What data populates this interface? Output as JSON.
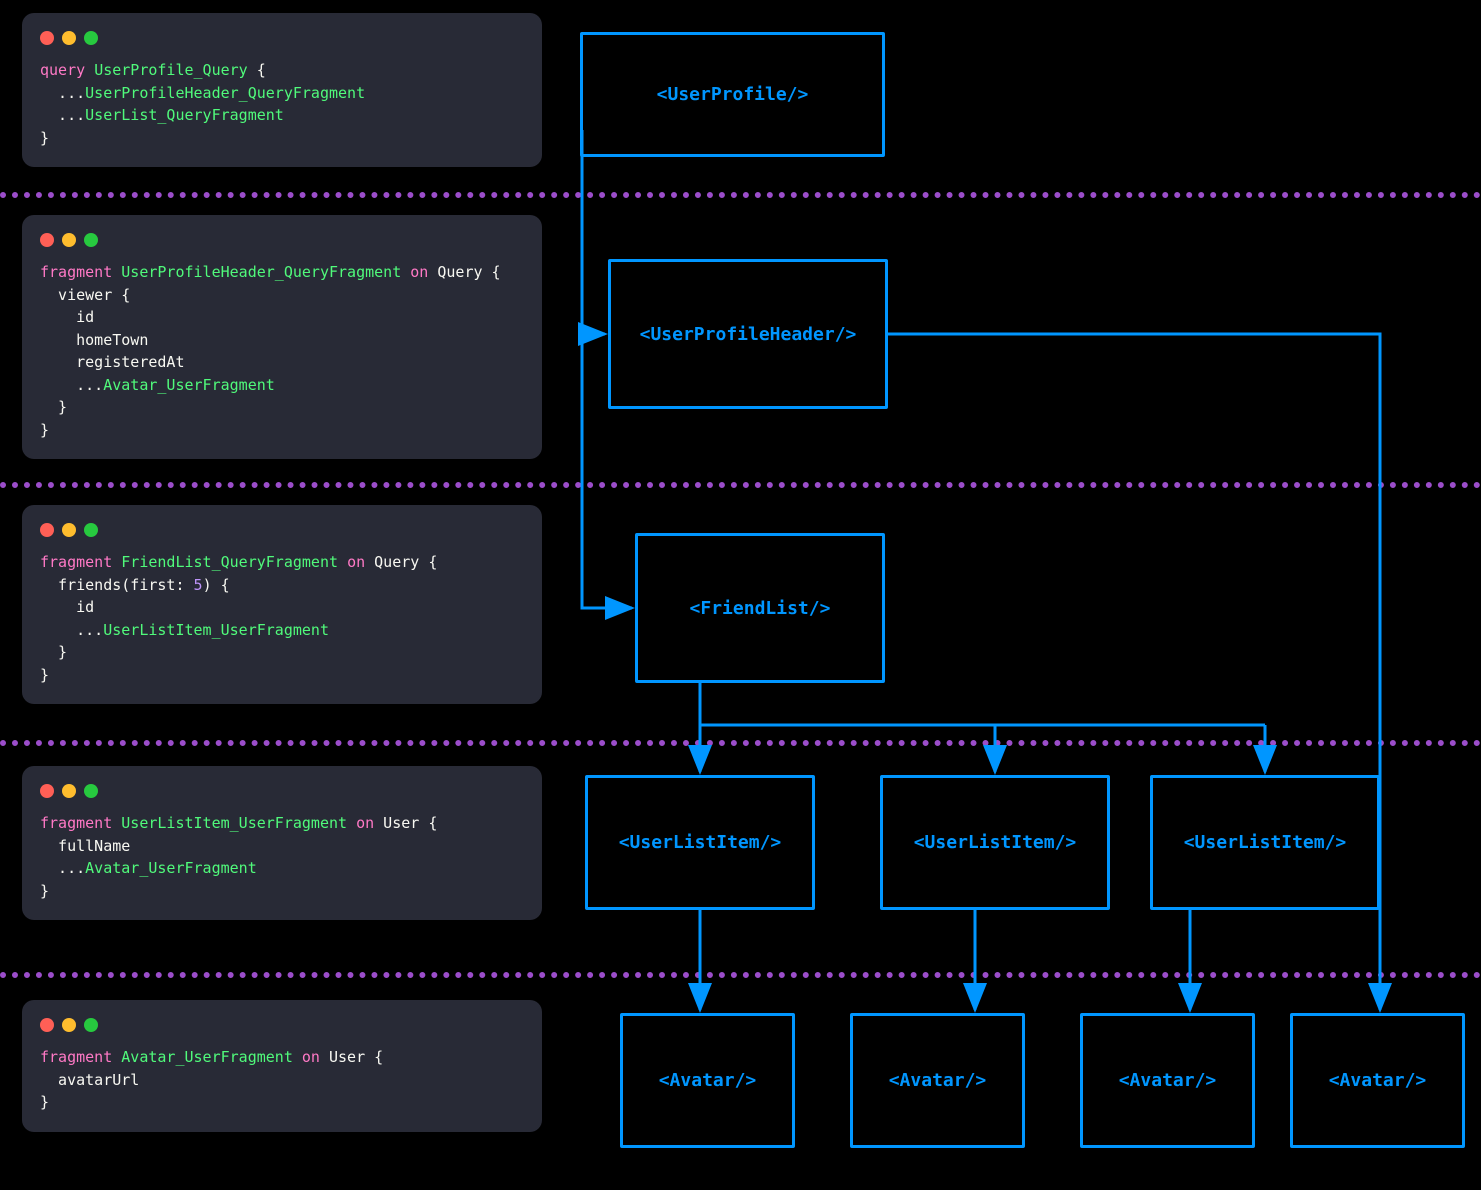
{
  "codePanels": [
    {
      "id": "query",
      "lines": [
        [
          {
            "cls": "kw",
            "text": "query"
          },
          {
            "cls": "",
            "text": " "
          },
          {
            "cls": "name",
            "text": "UserProfile_Query"
          },
          {
            "cls": "",
            "text": " {"
          }
        ],
        [
          {
            "cls": "",
            "text": "  ..."
          },
          {
            "cls": "name",
            "text": "UserProfileHeader_QueryFragment"
          }
        ],
        [
          {
            "cls": "",
            "text": "  ..."
          },
          {
            "cls": "name",
            "text": "UserList_QueryFragment"
          }
        ],
        [
          {
            "cls": "",
            "text": "}"
          }
        ]
      ]
    },
    {
      "id": "header-fragment",
      "lines": [
        [
          {
            "cls": "kw",
            "text": "fragment"
          },
          {
            "cls": "",
            "text": " "
          },
          {
            "cls": "name",
            "text": "UserProfileHeader_QueryFragment"
          },
          {
            "cls": "",
            "text": " "
          },
          {
            "cls": "on",
            "text": "on"
          },
          {
            "cls": "",
            "text": " Query {"
          }
        ],
        [
          {
            "cls": "",
            "text": "  viewer {"
          }
        ],
        [
          {
            "cls": "",
            "text": "    id"
          }
        ],
        [
          {
            "cls": "",
            "text": "    homeTown"
          }
        ],
        [
          {
            "cls": "",
            "text": "    registeredAt"
          }
        ],
        [
          {
            "cls": "",
            "text": "    ..."
          },
          {
            "cls": "name",
            "text": "Avatar_UserFragment"
          }
        ],
        [
          {
            "cls": "",
            "text": "  }"
          }
        ],
        [
          {
            "cls": "",
            "text": "}"
          }
        ]
      ]
    },
    {
      "id": "friendlist-fragment",
      "lines": [
        [
          {
            "cls": "kw",
            "text": "fragment"
          },
          {
            "cls": "",
            "text": " "
          },
          {
            "cls": "name",
            "text": "FriendList_QueryFragment"
          },
          {
            "cls": "",
            "text": " "
          },
          {
            "cls": "on",
            "text": "on"
          },
          {
            "cls": "",
            "text": " Query {"
          }
        ],
        [
          {
            "cls": "",
            "text": "  friends(first: "
          },
          {
            "cls": "num",
            "text": "5"
          },
          {
            "cls": "",
            "text": ") {"
          }
        ],
        [
          {
            "cls": "",
            "text": "    id"
          }
        ],
        [
          {
            "cls": "",
            "text": "    ..."
          },
          {
            "cls": "name",
            "text": "UserListItem_UserFragment"
          }
        ],
        [
          {
            "cls": "",
            "text": "  }"
          }
        ],
        [
          {
            "cls": "",
            "text": "}"
          }
        ]
      ]
    },
    {
      "id": "userlistitem-fragment",
      "lines": [
        [
          {
            "cls": "kw",
            "text": "fragment"
          },
          {
            "cls": "",
            "text": " "
          },
          {
            "cls": "name",
            "text": "UserListItem_UserFragment"
          },
          {
            "cls": "",
            "text": " "
          },
          {
            "cls": "on",
            "text": "on"
          },
          {
            "cls": "",
            "text": " User {"
          }
        ],
        [
          {
            "cls": "",
            "text": "  fullName"
          }
        ],
        [
          {
            "cls": "",
            "text": "  ..."
          },
          {
            "cls": "name",
            "text": "Avatar_UserFragment"
          }
        ],
        [
          {
            "cls": "",
            "text": "}"
          }
        ]
      ]
    },
    {
      "id": "avatar-fragment",
      "lines": [
        [
          {
            "cls": "kw",
            "text": "fragment"
          },
          {
            "cls": "",
            "text": " "
          },
          {
            "cls": "name",
            "text": "Avatar_UserFragment"
          },
          {
            "cls": "",
            "text": " "
          },
          {
            "cls": "on",
            "text": "on"
          },
          {
            "cls": "",
            "text": " User {"
          }
        ],
        [
          {
            "cls": "",
            "text": "  avatarUrl"
          }
        ],
        [
          {
            "cls": "",
            "text": "}"
          }
        ]
      ]
    }
  ],
  "components": {
    "userProfile": "<UserProfile/>",
    "userProfileHeader": "<UserProfileHeader/>",
    "friendList": "<FriendList/>",
    "userListItem1": "<UserListItem/>",
    "userListItem2": "<UserListItem/>",
    "userListItem3": "<UserListItem/>",
    "avatar1": "<Avatar/>",
    "avatar2": "<Avatar/>",
    "avatar3": "<Avatar/>",
    "avatar4": "<Avatar/>"
  }
}
